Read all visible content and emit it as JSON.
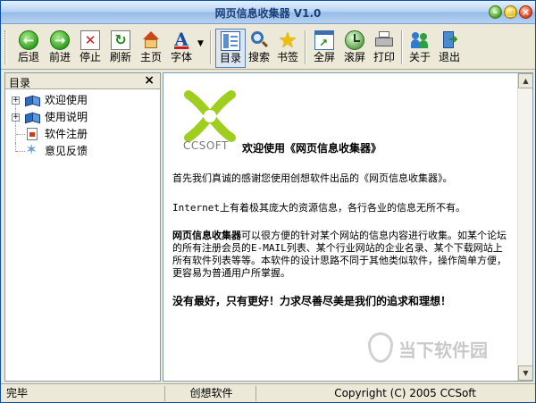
{
  "window": {
    "title": "网页信息收集器 V1.0"
  },
  "toolbar": {
    "back": "后退",
    "forward": "前进",
    "stop": "停止",
    "refresh": "刷新",
    "home": "主页",
    "font": "字体",
    "toc": "目录",
    "search": "搜索",
    "bookmark": "书签",
    "fullscreen": "全屏",
    "scroll": "滚屏",
    "print": "打印",
    "about": "关于",
    "exit": "退出"
  },
  "toc_panel": {
    "title": "目录",
    "items": [
      {
        "label": "欢迎使用"
      },
      {
        "label": "使用说明"
      },
      {
        "label": "软件注册"
      },
      {
        "label": "意见反馈"
      }
    ]
  },
  "content": {
    "logo_text": "CCSOFT",
    "welcome": "欢迎使用《网页信息收集器》",
    "para1": "首先我们真诚的感谢您使用创想软件出品的《网页信息收集器》。",
    "para2": "Internet上有着极其庞大的资源信息，各行各业的信息无所不有。",
    "para3_bold": "网页信息收集器",
    "para3_rest": "可以很方便的针对某个网站的信息内容进行收集。如某个论坛的所有注册会员的E-MAIL列表、某个行业网站的企业名录、某个下载网站上所有软件列表等等。本软件的设计思路不同于其他类似软件，操作简单方便，更容易为普通用户所掌握。",
    "para4": "没有最好，只有更好！力求尽善尽美是我们的追求和理想！",
    "watermark": "当下软件园"
  },
  "status": {
    "left": "完毕",
    "center": "创想软件",
    "right": "Copyright (C) 2005 CCSoft"
  }
}
